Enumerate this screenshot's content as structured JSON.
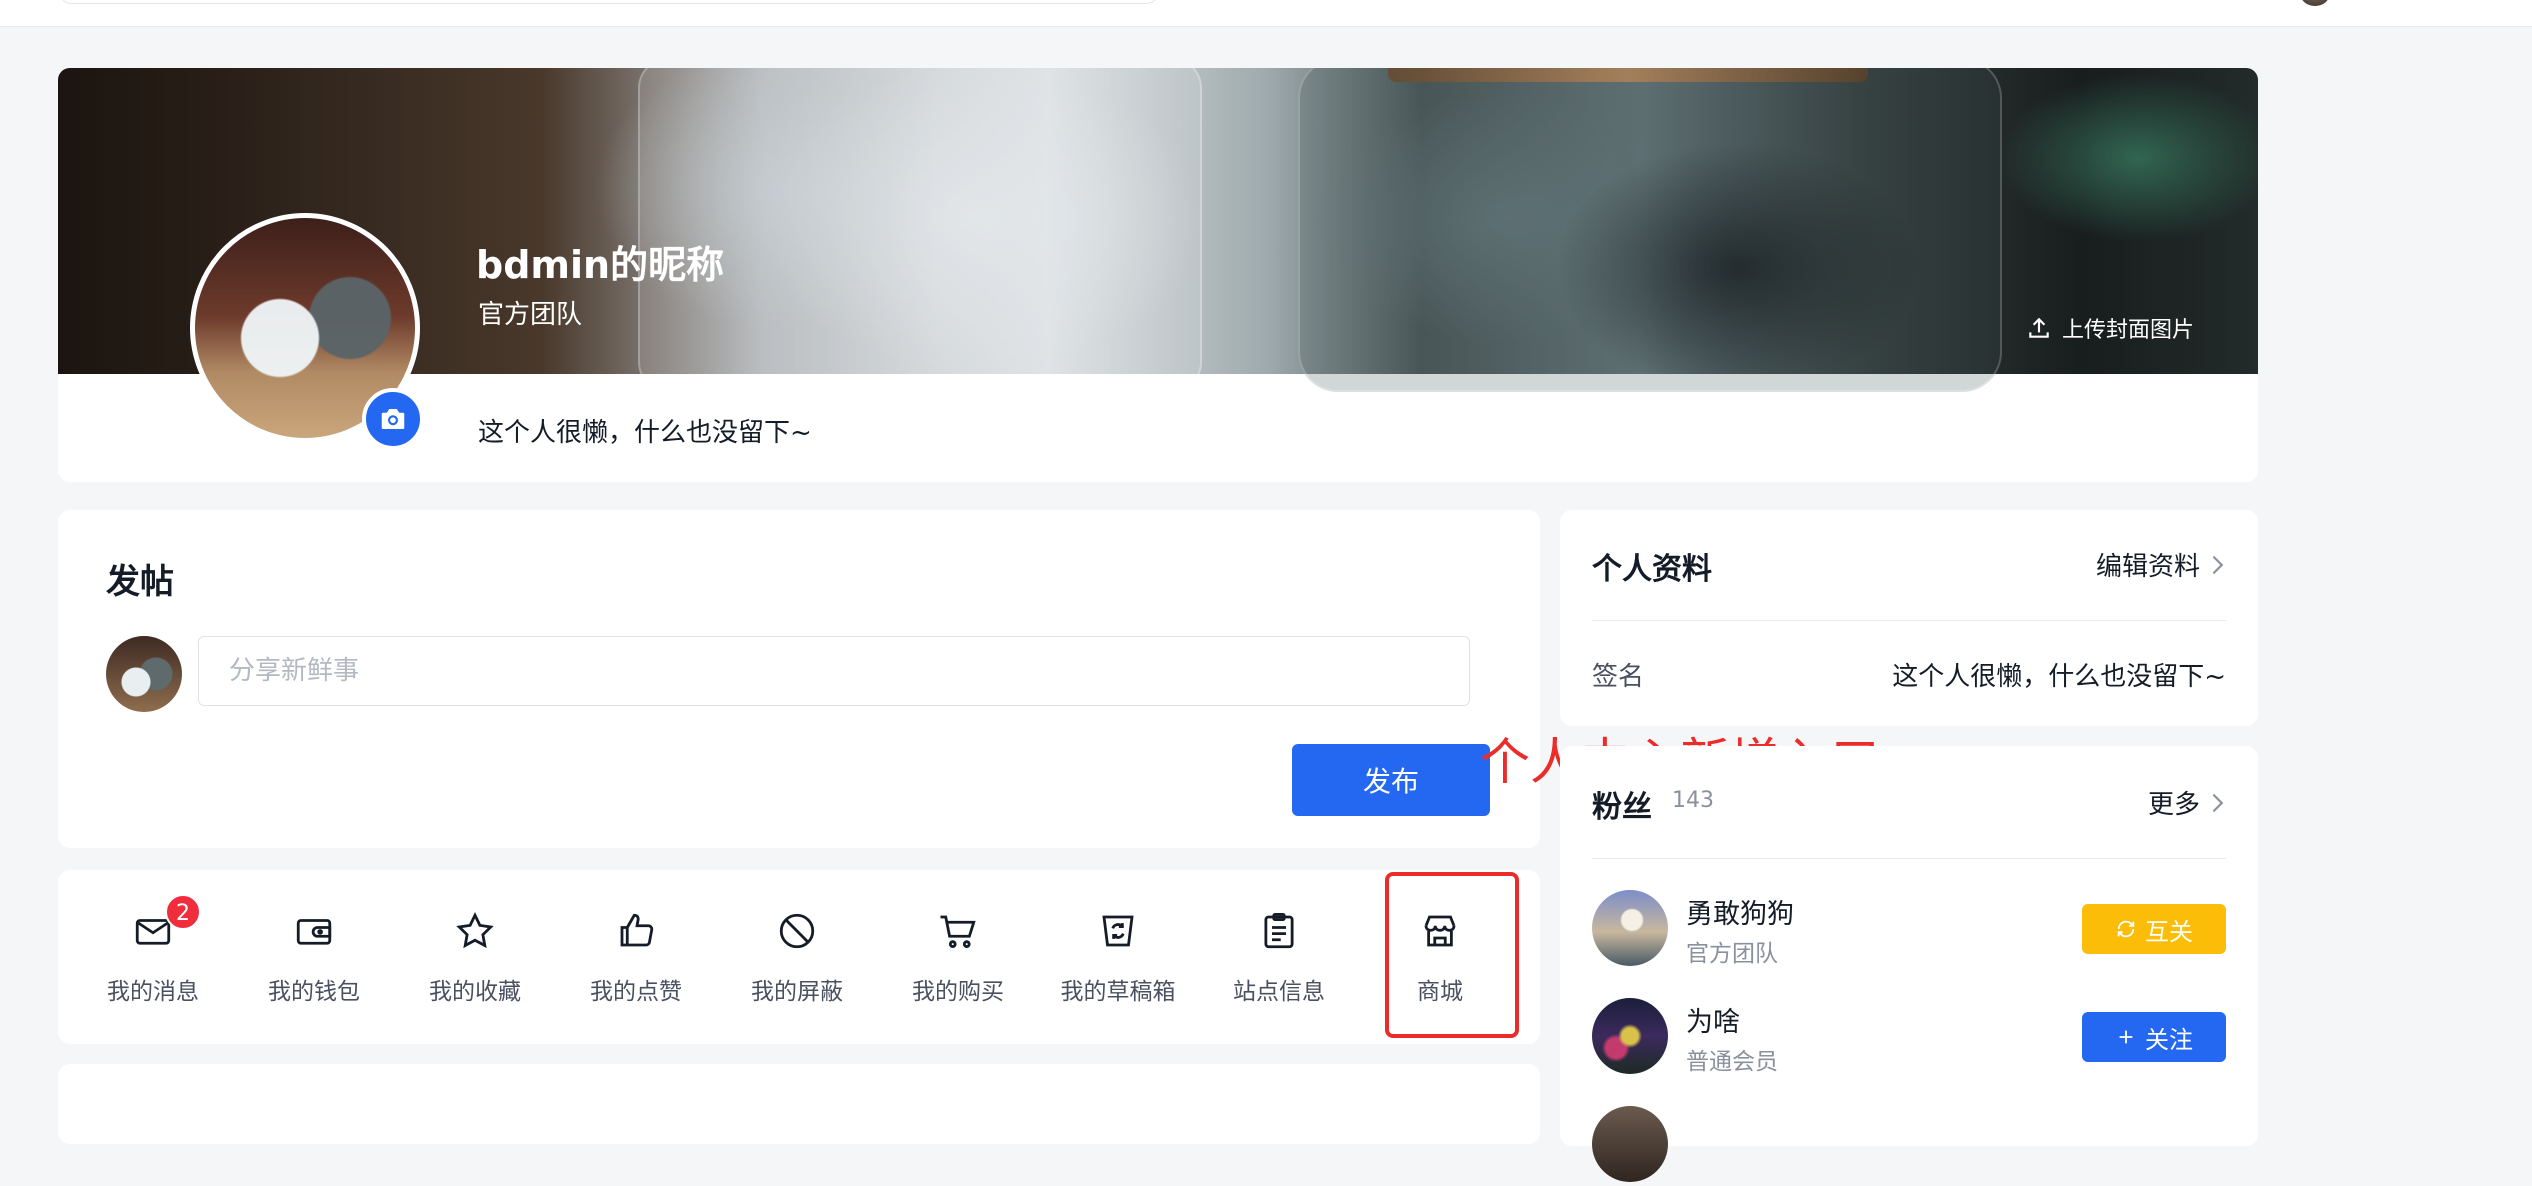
{
  "profile": {
    "nickname": "bdmin的昵称",
    "team": "官方团队",
    "bio": "这个人很懒，什么也没留下~",
    "upload_cover_label": "上传封面图片"
  },
  "post": {
    "title": "发帖",
    "placeholder": "分享新鲜事",
    "publish_label": "发布"
  },
  "menu": {
    "items": [
      {
        "label": "我的消息",
        "icon": "mail-icon",
        "badge": "2"
      },
      {
        "label": "我的钱包",
        "icon": "wallet-icon"
      },
      {
        "label": "我的收藏",
        "icon": "star-icon"
      },
      {
        "label": "我的点赞",
        "icon": "thumbs-up-icon"
      },
      {
        "label": "我的屏蔽",
        "icon": "block-icon"
      },
      {
        "label": "我的购买",
        "icon": "cart-icon"
      },
      {
        "label": "我的草稿箱",
        "icon": "draft-box-icon"
      },
      {
        "label": "站点信息",
        "icon": "clipboard-icon"
      },
      {
        "label": "商城",
        "icon": "store-icon"
      }
    ]
  },
  "annotation": {
    "text": "个人中心新增入口",
    "color": "#ec2b2b"
  },
  "personal_info": {
    "title": "个人资料",
    "edit_label": "编辑资料",
    "signature_label": "签名",
    "signature_value": "这个人很懒，什么也没留下~"
  },
  "fans": {
    "title": "粉丝",
    "count": "143",
    "more_label": "更多",
    "list": [
      {
        "name": "勇敢狗狗",
        "role": "官方团队",
        "button": "互关",
        "button_color": "#fbbd08"
      },
      {
        "name": "为啥",
        "role": "普通会员",
        "button": "关注",
        "button_color": "#2468f2"
      }
    ]
  },
  "colors": {
    "primary": "#2468f2",
    "mutual": "#fbbd08",
    "badge": "#f02d3c"
  }
}
